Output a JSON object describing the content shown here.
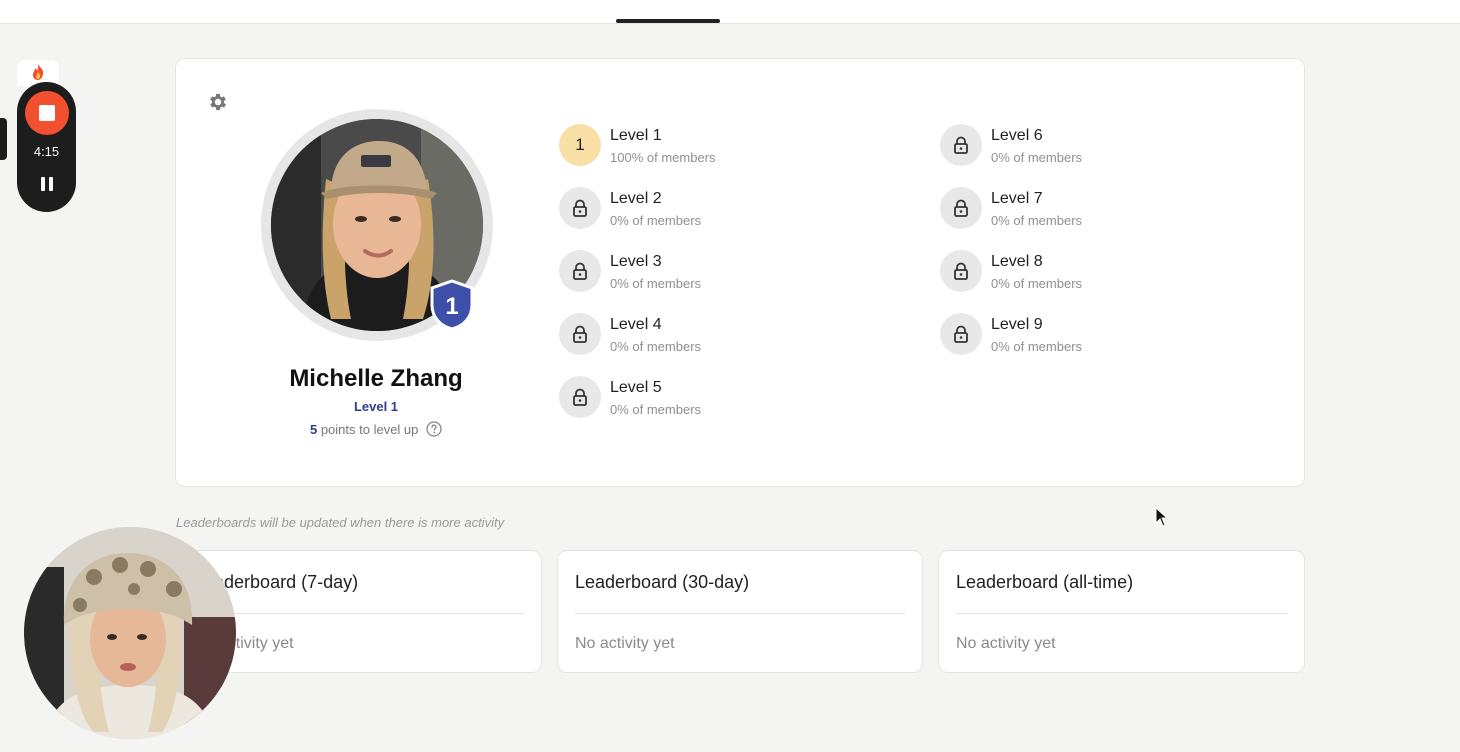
{
  "recorder": {
    "timer": "4:15"
  },
  "profile": {
    "name": "Michelle Zhang",
    "level_label": "Level 1",
    "badge_number": "1",
    "points_value": "5",
    "points_text": " points to level up"
  },
  "levels": [
    {
      "name": "Level 1",
      "percent": "100% of members",
      "number": "1",
      "unlocked": true
    },
    {
      "name": "Level 2",
      "percent": "0% of members",
      "unlocked": false
    },
    {
      "name": "Level 3",
      "percent": "0% of members",
      "unlocked": false
    },
    {
      "name": "Level 4",
      "percent": "0% of members",
      "unlocked": false
    },
    {
      "name": "Level 5",
      "percent": "0% of members",
      "unlocked": false
    },
    {
      "name": "Level 6",
      "percent": "0% of members",
      "unlocked": false
    },
    {
      "name": "Level 7",
      "percent": "0% of members",
      "unlocked": false
    },
    {
      "name": "Level 8",
      "percent": "0% of members",
      "unlocked": false
    },
    {
      "name": "Level 9",
      "percent": "0% of members",
      "unlocked": false
    }
  ],
  "leaderboard_note": "Leaderboards will be updated when there is more activity",
  "leaderboards": [
    {
      "title": "Leaderboard (7-day)",
      "empty": "No activity yet"
    },
    {
      "title": "Leaderboard (30-day)",
      "empty": "No activity yet"
    },
    {
      "title": "Leaderboard (all-time)",
      "empty": "No activity yet"
    }
  ],
  "icons": {
    "settings": "gear-icon",
    "locked": "lock-icon",
    "help": "question-circle-icon",
    "badge": "shield-icon",
    "stop": "stop-icon",
    "pause": "pause-icon"
  },
  "colors": {
    "brand_blue": "#2e3e8f",
    "level_unlocked": "#f8dfa5",
    "level_locked": "#e8e8e8",
    "record_red": "#f2502e",
    "page_bg": "#f4f4f2"
  }
}
